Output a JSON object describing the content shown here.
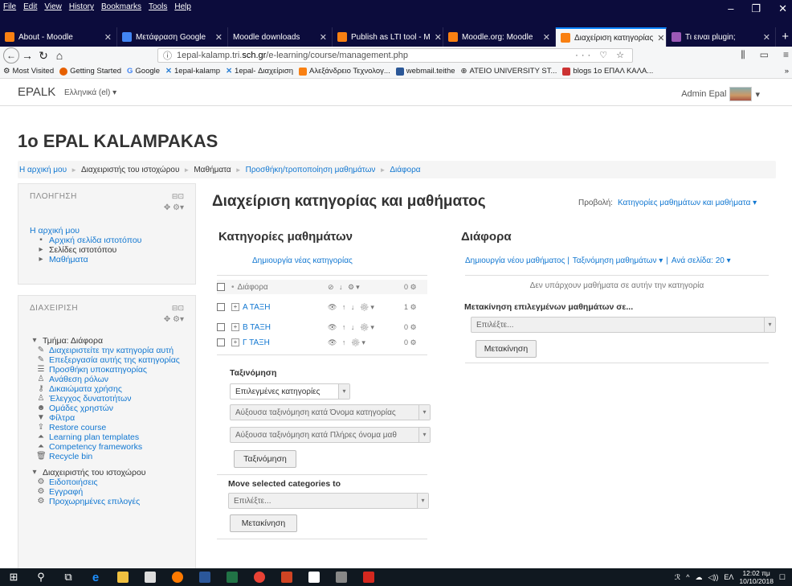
{
  "browser": {
    "menus": [
      "File",
      "Edit",
      "View",
      "History",
      "Bookmarks",
      "Tools",
      "Help"
    ],
    "tabs": [
      {
        "title": "About - Moodle",
        "color": "#f98012"
      },
      {
        "title": "Μετάφραση Google",
        "color": "#4285f4"
      },
      {
        "title": "Moodle downloads",
        "color": "#444444"
      },
      {
        "title": "Publish as LTI tool - M",
        "color": "#f98012"
      },
      {
        "title": "Moodle.org: Moodle",
        "color": "#f98012"
      },
      {
        "title": "Διαχείριση κατηγορίας",
        "color": "#f98012"
      },
      {
        "title": "Τι ειναι plugin;",
        "color": "#9b59b6"
      }
    ],
    "url_prefix": "1epal-kalamp.tri.",
    "url_host": "sch.gr",
    "url_path": "/e-learning/course/management.php",
    "url_actions": "··· ♡ ☆",
    "bookmarks": [
      {
        "label": "Most Visited",
        "color": "#555555"
      },
      {
        "label": "Getting Started",
        "color": "#e66000"
      },
      {
        "label": "Google",
        "color": "#4285f4"
      },
      {
        "label": "1epal-kalamp",
        "color": "#2a7fd4"
      },
      {
        "label": "1epal- Διαχείριση",
        "color": "#2a7fd4"
      },
      {
        "label": "Αλεξάνδρειο Τεχνολογ...",
        "color": "#f98012"
      },
      {
        "label": "webmail.teithe",
        "color": "#2b5797"
      },
      {
        "label": "ATEIO UNIVERSITY ST...",
        "color": "#333333"
      },
      {
        "label": "blogs 1o ΕΠΑΛ ΚΑΛΑ...",
        "color": "#cc3333"
      }
    ]
  },
  "moodle": {
    "brand": "EPALK",
    "lang": "Ελληνικά (el) ▾",
    "user": "Admin Epal",
    "site_title": "1o EPAL KALAMPAKAS",
    "breadcrumb": [
      {
        "label": "Η αρχική μου",
        "link": true
      },
      {
        "label": "Διαχειριστής του ιστοχώρου",
        "link": false
      },
      {
        "label": "Μαθήματα",
        "link": false
      },
      {
        "label": "Προσθήκη/τροποποίηση μαθημάτων",
        "link": true
      },
      {
        "label": "Διάφορα",
        "link": true
      }
    ]
  },
  "nav_block": {
    "title": "ΠΛΟΗΓΗΣΗ",
    "home": "Η αρχική μου",
    "items": [
      "Αρχική σελίδα ιστοτόπου",
      "Σελίδες ιστοτόπου",
      "Μαθήματα"
    ]
  },
  "admin_block": {
    "title": "ΔΙΑΧΕΙΡΙΣΗ",
    "section": "Τμήμα: Διάφορα",
    "items": [
      "Διαχειριστείτε την κατηγορία αυτή",
      "Επεξεργασία αυτής της κατηγορίας",
      "Προσθήκη υποκατηγορίας",
      "Ανάθεση ρόλων",
      "Δικαιώματα χρήσης",
      "Έλεγχος δυνατοτήτων",
      "Ομάδες χρηστών",
      "Φίλτρα",
      "Restore course",
      "Learning plan templates",
      "Competency frameworks",
      "Recycle bin"
    ],
    "section2": "Διαχειριστής του ιστοχώρου",
    "items2": [
      "Ειδοποιήσεις",
      "Εγγραφή",
      "Προχωρημένες επιλογές"
    ]
  },
  "main": {
    "title": "Διαχείριση κατηγορίας και μαθήματος",
    "view_label": "Προβολή:",
    "view_value": "Κατηγορίες μαθημάτων και μαθήματα ▾",
    "categories_heading": "Κατηγορίες μαθημάτων",
    "new_category": "Δημιουργία νέας κατηγορίας",
    "categories": [
      {
        "name": "Διάφορα",
        "count": "0"
      },
      {
        "name": "Α ΤΑΞΗ",
        "count": "1"
      },
      {
        "name": "Β ΤΑΞΗ",
        "count": "0"
      },
      {
        "name": "Γ ΤΑΞΗ",
        "count": "0"
      }
    ],
    "sort_heading": "Ταξινόμηση",
    "sort_scope": "Επιλεγμένες κατηγορίες",
    "sort_by_name": "Αύξουσα ταξινόμηση κατά Όνομα κατηγορίας",
    "sort_by_fullname": "Αύξουσα ταξινόμηση κατά Πλήρες όνομα μαθ",
    "sort_button": "Ταξινόμηση",
    "move_cats_heading": "Move selected categories to",
    "move_cats_select": "Επιλέξτε...",
    "move_cats_button": "Μετακίνηση",
    "courses_heading": "Διάφορα",
    "new_course": "Δημιουργία νέου μαθήματος |",
    "sort_courses": "Ταξινόμηση μαθημάτων ▾",
    "sep": "|",
    "per_page": "Ανά σελίδα: 20 ▾",
    "no_courses": "Δεν υπάρχουν μαθήματα σε αυτήν την κατηγορία",
    "move_courses_heading": "Μετακίνηση επιλεγμένων μαθημάτων σε...",
    "move_courses_select": "Επιλέξτε...",
    "move_courses_button": "Μετακίνηση"
  },
  "taskbar": {
    "lang": "ΕΛ",
    "time": "12:02 πμ",
    "date": "10/10/2018"
  }
}
